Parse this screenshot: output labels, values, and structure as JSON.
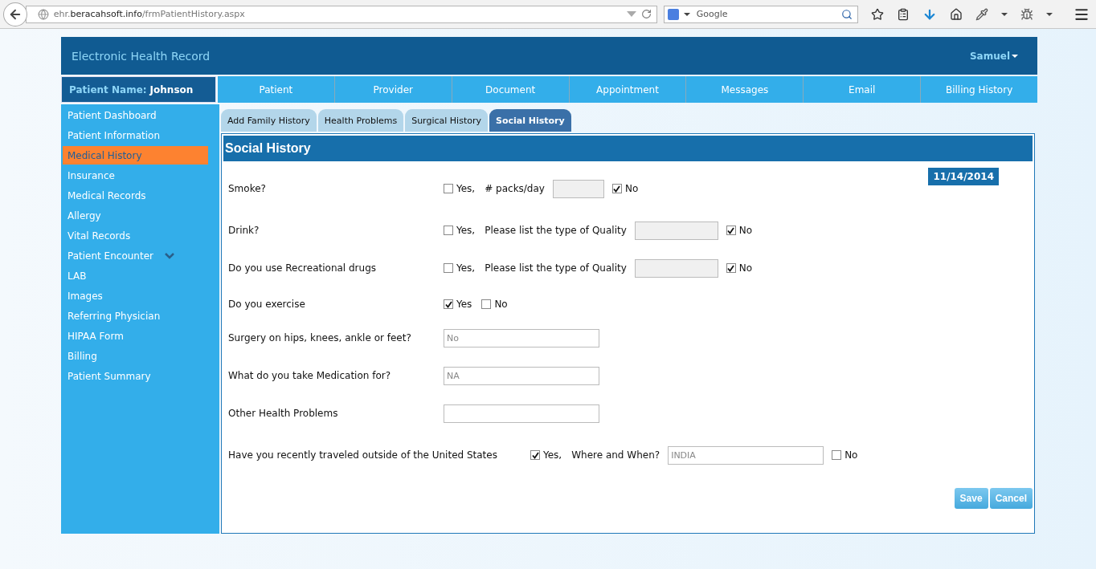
{
  "browser": {
    "url": "ehr.**beracahsoft.info**/frmPatientHistory.aspx",
    "search_placeholder": "Google"
  },
  "header": {
    "title": "Electronic Health Record",
    "user": "Samuel"
  },
  "patient": {
    "label": "Patient Name:",
    "name": "Johnson"
  },
  "nav_tabs": [
    "Patient",
    "Provider",
    "Document",
    "Appointment",
    "Messages",
    "Email",
    "Billing History"
  ],
  "sidebar": {
    "items": [
      {
        "label": "Patient Dashboard",
        "selected": false,
        "kind": "link"
      },
      {
        "label": "Patient Information",
        "selected": false,
        "kind": "link"
      },
      {
        "label": "Medical History",
        "selected": true,
        "kind": "link"
      },
      {
        "label": "Insurance",
        "selected": false,
        "kind": "link"
      },
      {
        "label": "Medical Records",
        "selected": false,
        "kind": "link"
      },
      {
        "label": "Allergy",
        "selected": false,
        "kind": "link"
      },
      {
        "label": "Vital Records",
        "selected": false,
        "kind": "link"
      },
      {
        "label": "Patient Encounter",
        "selected": false,
        "kind": "group"
      },
      {
        "label": "LAB",
        "selected": false,
        "kind": "link"
      },
      {
        "label": "Images",
        "selected": false,
        "kind": "link"
      },
      {
        "label": "Referring Physician",
        "selected": false,
        "kind": "link"
      },
      {
        "label": "HIPAA Form",
        "selected": false,
        "kind": "link"
      },
      {
        "label": "Billing",
        "selected": false,
        "kind": "link"
      },
      {
        "label": "Patient Summary",
        "selected": false,
        "kind": "link"
      }
    ]
  },
  "sub_tabs": [
    {
      "label": "Add Family History",
      "selected": false
    },
    {
      "label": "Health Problems",
      "selected": false
    },
    {
      "label": "Surgical History",
      "selected": false
    },
    {
      "label": "Social History",
      "selected": true
    }
  ],
  "panel": {
    "title": "Social History",
    "date": "11/14/2014",
    "rows": [
      {
        "label": "Smoke?",
        "controls": [
          {
            "kind": "checkbox",
            "label": "Yes,",
            "checked": false
          },
          {
            "kind": "text",
            "label": "# packs/day"
          },
          {
            "kind": "input",
            "disabled": true
          },
          {
            "kind": "checkbox",
            "label": "No",
            "checked": true
          }
        ]
      },
      {
        "label": "Drink?",
        "controls": [
          {
            "kind": "checkbox",
            "label": "Yes,",
            "checked": false
          },
          {
            "kind": "text",
            "label": "Please list the type of Quality"
          },
          {
            "kind": "input",
            "disabled": true
          },
          {
            "kind": "checkbox",
            "label": "No",
            "checked": true
          }
        ]
      },
      {
        "label": "Do you use Recreational drugs",
        "controls": [
          {
            "kind": "checkbox",
            "label": "Yes,",
            "checked": false
          },
          {
            "kind": "text",
            "label": "Please list the type of Quality"
          },
          {
            "kind": "input",
            "disabled": true
          },
          {
            "kind": "checkbox",
            "label": "No",
            "checked": true
          }
        ]
      },
      {
        "label": "Do you exercise",
        "controls": [
          {
            "kind": "checkbox",
            "label": "Yes",
            "checked": true
          },
          {
            "kind": "checkbox",
            "label": "No",
            "checked": false
          }
        ]
      },
      {
        "label": "Surgery on hips, knees, ankle or feet?",
        "controls": [
          {
            "kind": "input",
            "disabled": false,
            "value": "No"
          }
        ]
      },
      {
        "label": "What do you take Medication for?",
        "controls": [
          {
            "kind": "input",
            "disabled": false,
            "value": "NA"
          }
        ]
      },
      {
        "label": "Other Health Problems",
        "controls": [
          {
            "kind": "input",
            "disabled": false
          }
        ]
      },
      {
        "label": "Have you recently traveled outside of the United States",
        "controls": [
          {
            "kind": "checkbox",
            "label": "Yes,",
            "checked": true
          },
          {
            "kind": "text",
            "label": "Where and When?"
          },
          {
            "kind": "input",
            "disabled": false,
            "value": "INDIA"
          },
          {
            "kind": "checkbox",
            "label": "No",
            "checked": false
          }
        ]
      }
    ]
  },
  "buttons": [
    "Save",
    "Cancel"
  ]
}
